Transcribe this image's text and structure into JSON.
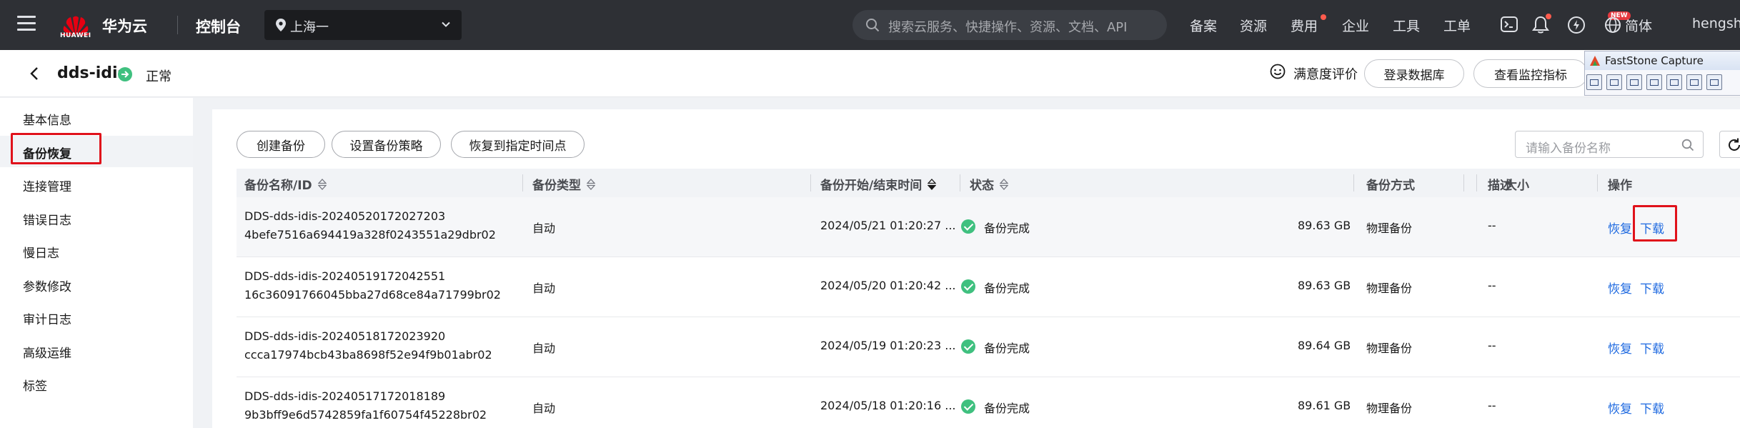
{
  "topbar": {
    "logo_text": "HUAWEI",
    "brand": "华为云",
    "console": "控制台",
    "region": "上海一",
    "search_placeholder": "搜索云服务、快捷操作、资源、文档、API",
    "nav": [
      "备案",
      "资源",
      "费用",
      "企业",
      "工具",
      "工单"
    ],
    "new_badge": "NEW",
    "language": "简体",
    "user": "hengshi"
  },
  "header": {
    "instance_name": "dds-idis",
    "instance_status": "正常",
    "rate_label": "满意度评价",
    "login_db_label": "登录数据库",
    "monitor_label": "查看监控指标"
  },
  "faststone": {
    "title": "FastStone Capture"
  },
  "sidebar": {
    "items": [
      {
        "label": "基本信息"
      },
      {
        "label": "备份恢复"
      },
      {
        "label": "连接管理"
      },
      {
        "label": "错误日志"
      },
      {
        "label": "慢日志"
      },
      {
        "label": "参数修改"
      },
      {
        "label": "审计日志"
      },
      {
        "label": "高级运维"
      },
      {
        "label": "标签"
      }
    ],
    "active_index": 1
  },
  "toolbar": {
    "create_label": "创建备份",
    "policy_label": "设置备份策略",
    "restore_point_label": "恢复到指定时间点",
    "filter_placeholder": "请输入备份名称"
  },
  "table": {
    "columns": {
      "name": "备份名称/ID",
      "type": "备份类型",
      "time": "备份开始/结束时间",
      "status": "状态",
      "size": "大小",
      "method": "备份方式",
      "desc": "描述",
      "ops": "操作"
    },
    "rows": [
      {
        "name": "DDS-dds-idis-20240520172027203",
        "id": "4befe7516a694419a328f0243551a29dbr02",
        "type": "自动",
        "time": "2024/05/21 01:20:27 ...",
        "status": "备份完成",
        "size": "89.63 GB",
        "method": "物理备份",
        "desc": "--",
        "restore": "恢复",
        "download": "下载"
      },
      {
        "name": "DDS-dds-idis-20240519172042551",
        "id": "16c36091766045bba27d68ce84a71799br02",
        "type": "自动",
        "time": "2024/05/20 01:20:42 ...",
        "status": "备份完成",
        "size": "89.63 GB",
        "method": "物理备份",
        "desc": "--",
        "restore": "恢复",
        "download": "下载"
      },
      {
        "name": "DDS-dds-idis-20240518172023920",
        "id": "ccca17974bcb43ba8698f52e94f9b01abr02",
        "type": "自动",
        "time": "2024/05/19 01:20:23 ...",
        "status": "备份完成",
        "size": "89.64 GB",
        "method": "物理备份",
        "desc": "--",
        "restore": "恢复",
        "download": "下载"
      },
      {
        "name": "DDS-dds-idis-20240517172018189",
        "id": "9b3bff9e6d5742859fa1f60754f45228br02",
        "type": "自动",
        "time": "2024/05/18 01:20:16 ...",
        "status": "备份完成",
        "size": "89.61 GB",
        "method": "物理备份",
        "desc": "--",
        "restore": "恢复",
        "download": "下载"
      }
    ]
  },
  "colors": {
    "topbar_bg": "#2e3035",
    "link": "#1f6ae0",
    "success": "#3fc07f",
    "highlight_box": "#e0121b"
  }
}
